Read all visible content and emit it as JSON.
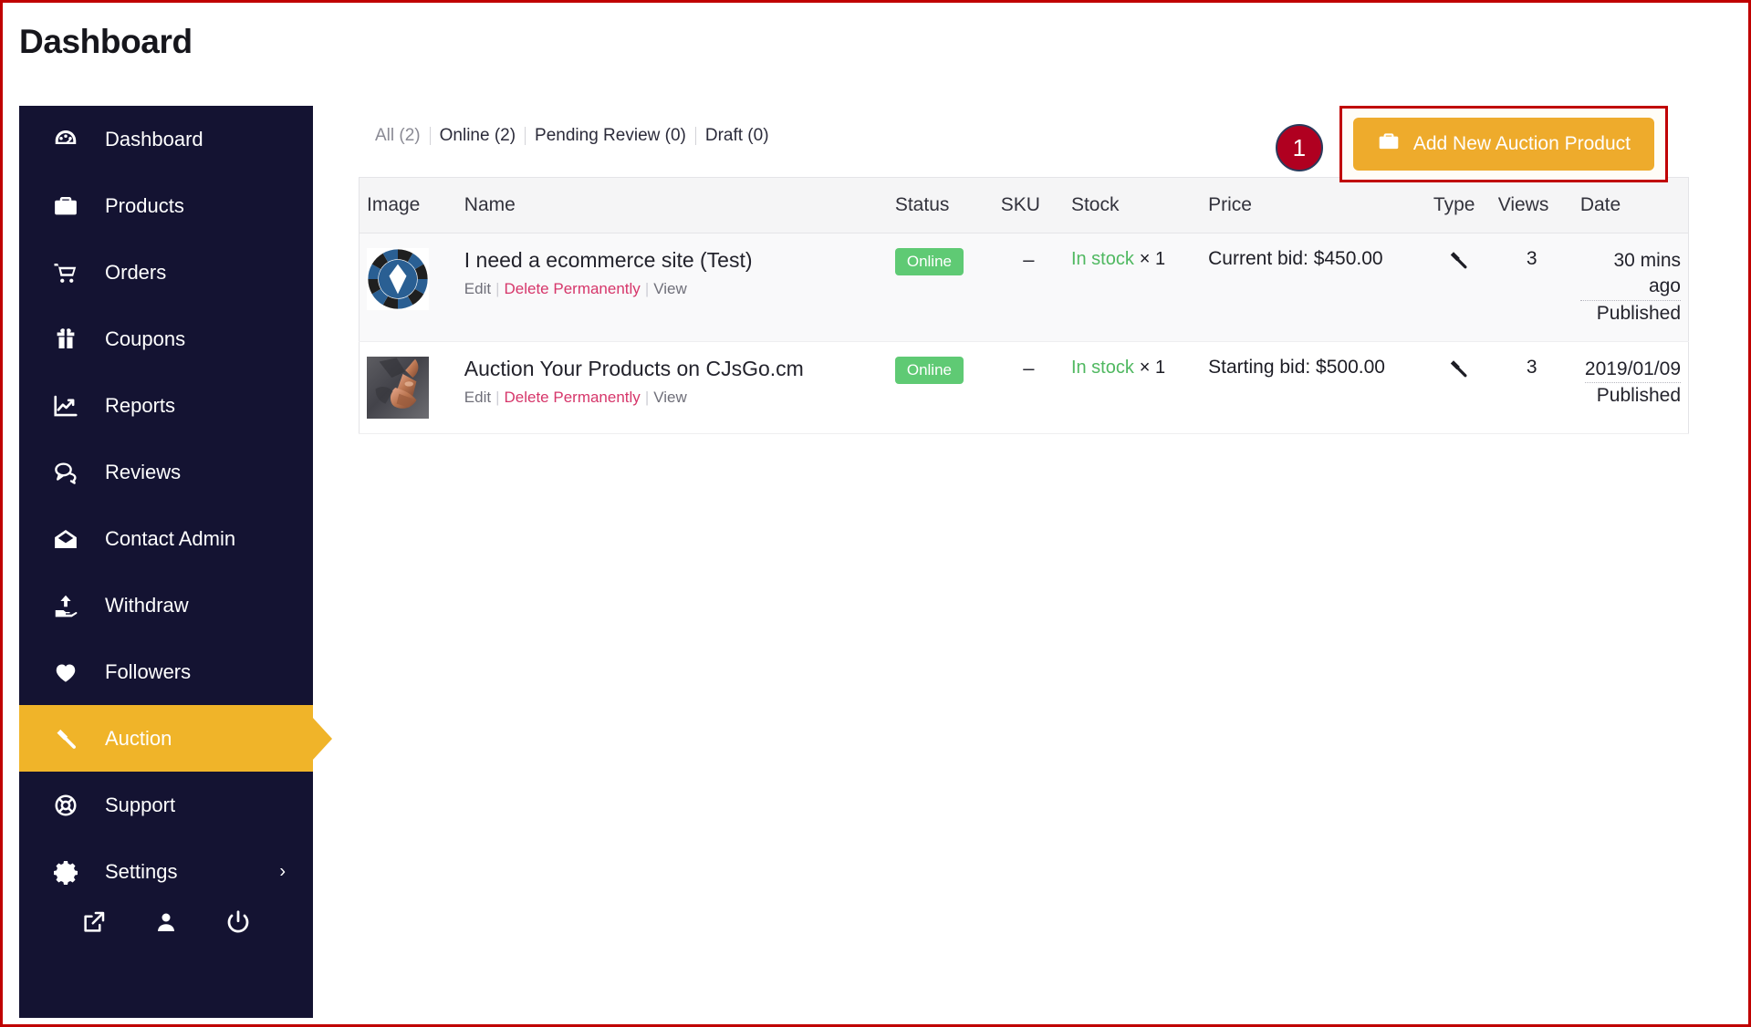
{
  "page": {
    "title": "Dashboard"
  },
  "sidebar": {
    "items": [
      {
        "label": "Dashboard",
        "icon": "speedometer-icon",
        "active": false
      },
      {
        "label": "Products",
        "icon": "briefcase-icon",
        "active": false
      },
      {
        "label": "Orders",
        "icon": "shopping-cart-icon",
        "active": false
      },
      {
        "label": "Coupons",
        "icon": "gift-icon",
        "active": false
      },
      {
        "label": "Reports",
        "icon": "chart-line-icon",
        "active": false
      },
      {
        "label": "Reviews",
        "icon": "speech-bubble-icon",
        "active": false
      },
      {
        "label": "Contact Admin",
        "icon": "envelope-icon",
        "active": false
      },
      {
        "label": "Withdraw",
        "icon": "upload-hand-icon",
        "active": false
      },
      {
        "label": "Followers",
        "icon": "heart-icon",
        "active": false
      },
      {
        "label": "Auction",
        "icon": "gavel-icon",
        "active": true
      },
      {
        "label": "Support",
        "icon": "lifebuoy-icon",
        "active": false
      },
      {
        "label": "Settings",
        "icon": "gear-icon",
        "active": false,
        "chevron": "›"
      }
    ],
    "footer_icons": [
      {
        "name": "external-link-icon"
      },
      {
        "name": "user-icon"
      },
      {
        "name": "power-icon"
      }
    ]
  },
  "toolbar": {
    "filters": [
      {
        "label": "All (2)",
        "current": true
      },
      {
        "label": "Online (2)",
        "current": false
      },
      {
        "label": "Pending Review (0)",
        "current": false
      },
      {
        "label": "Draft (0)",
        "current": false
      }
    ],
    "badge": "1",
    "add_button_label": "Add New Auction Product",
    "add_button_icon": "briefcase-icon"
  },
  "table": {
    "headers": [
      "Image",
      "Name",
      "Status",
      "SKU",
      "Stock",
      "Price",
      "Type",
      "Views",
      "Date"
    ],
    "rows": [
      {
        "thumb": "eos-logo-thumbnail",
        "name": "I need a ecommerce site (Test)",
        "actions": {
          "edit": "Edit",
          "delete": "Delete Permanently",
          "view": "View"
        },
        "status": "Online",
        "sku": "–",
        "stock": "In stock",
        "stock_qty": "× 1",
        "price": "Current bid: $450.00",
        "type_icon": "gavel-icon",
        "views": "3",
        "date": "30 mins ago",
        "date_status": "Published"
      },
      {
        "thumb": "copper-product-photo",
        "name": "Auction Your Products on CJsGo.cm",
        "actions": {
          "edit": "Edit",
          "delete": "Delete Permanently",
          "view": "View"
        },
        "status": "Online",
        "sku": "–",
        "stock": "In stock",
        "stock_qty": "× 1",
        "price": "Starting bid: $500.00",
        "type_icon": "gavel-icon",
        "views": "3",
        "date": "2019/01/09",
        "date_status": "Published"
      }
    ]
  },
  "colors": {
    "sidebar_bg": "#141332",
    "accent_amber": "#f0b429",
    "button_amber": "#eeab2c",
    "status_green": "#5fca74",
    "instock_green": "#4fb860",
    "delete_pink": "#d6366a",
    "badge_red": "#b00020",
    "annotation_red": "#c00000"
  }
}
